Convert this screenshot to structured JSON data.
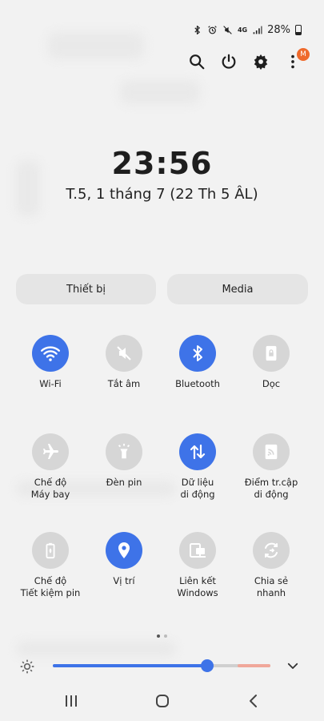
{
  "status_bar": {
    "battery_text": "28%",
    "network_label": "4G",
    "icons": [
      "bluetooth-icon",
      "alarm-icon",
      "mute-icon",
      "mobile-data-4g-icon",
      "signal-icon",
      "battery-icon"
    ]
  },
  "top_actions": {
    "icons": [
      "search-icon",
      "power-icon",
      "settings-icon",
      "more-options-icon"
    ],
    "badge_letter": "M",
    "badge_color": "#ef6a2c"
  },
  "clock": {
    "time": "23:56",
    "date": "T.5, 1 tháng 7 (22 Th 5 ÂL)"
  },
  "segments": {
    "devices_label": "Thiết bị",
    "media_label": "Media"
  },
  "tiles": [
    {
      "label_line1": "Wi-Fi",
      "label_line2": "",
      "icon": "wifi-icon",
      "on": true
    },
    {
      "label_line1": "Tắt âm",
      "label_line2": "",
      "icon": "mute-icon",
      "on": false
    },
    {
      "label_line1": "Bluetooth",
      "label_line2": "",
      "icon": "bluetooth-icon",
      "on": true
    },
    {
      "label_line1": "Dọc",
      "label_line2": "",
      "icon": "portrait-lock-icon",
      "on": false
    },
    {
      "label_line1": "Chế độ",
      "label_line2": "Máy bay",
      "icon": "airplane-icon",
      "on": false
    },
    {
      "label_line1": "Đèn pin",
      "label_line2": "",
      "icon": "flashlight-icon",
      "on": false
    },
    {
      "label_line1": "Dữ liệu",
      "label_line2": "di động",
      "icon": "mobile-data-icon",
      "on": true
    },
    {
      "label_line1": "Điểm tr.cập",
      "label_line2": "di động",
      "icon": "hotspot-icon",
      "on": false
    },
    {
      "label_line1": "Chế độ",
      "label_line2": "Tiết kiệm pin",
      "icon": "power-saving-icon",
      "on": false
    },
    {
      "label_line1": "Vị trí",
      "label_line2": "",
      "icon": "location-icon",
      "on": true
    },
    {
      "label_line1": "Liên kết",
      "label_line2": "Windows",
      "icon": "link-windows-icon",
      "on": false
    },
    {
      "label_line1": "Chia sẻ",
      "label_line2": "nhanh",
      "icon": "quick-share-icon",
      "on": false
    }
  ],
  "pager": {
    "pages": 2,
    "active": 0
  },
  "brightness": {
    "level": 0.71,
    "accent": "#3e73e8"
  },
  "colors": {
    "accent": "#3e73e8",
    "tile_off": "#d6d6d6",
    "background": "#f2f2f2"
  },
  "navbar": {
    "icons": [
      "recent-apps-icon",
      "home-icon",
      "back-icon"
    ]
  }
}
